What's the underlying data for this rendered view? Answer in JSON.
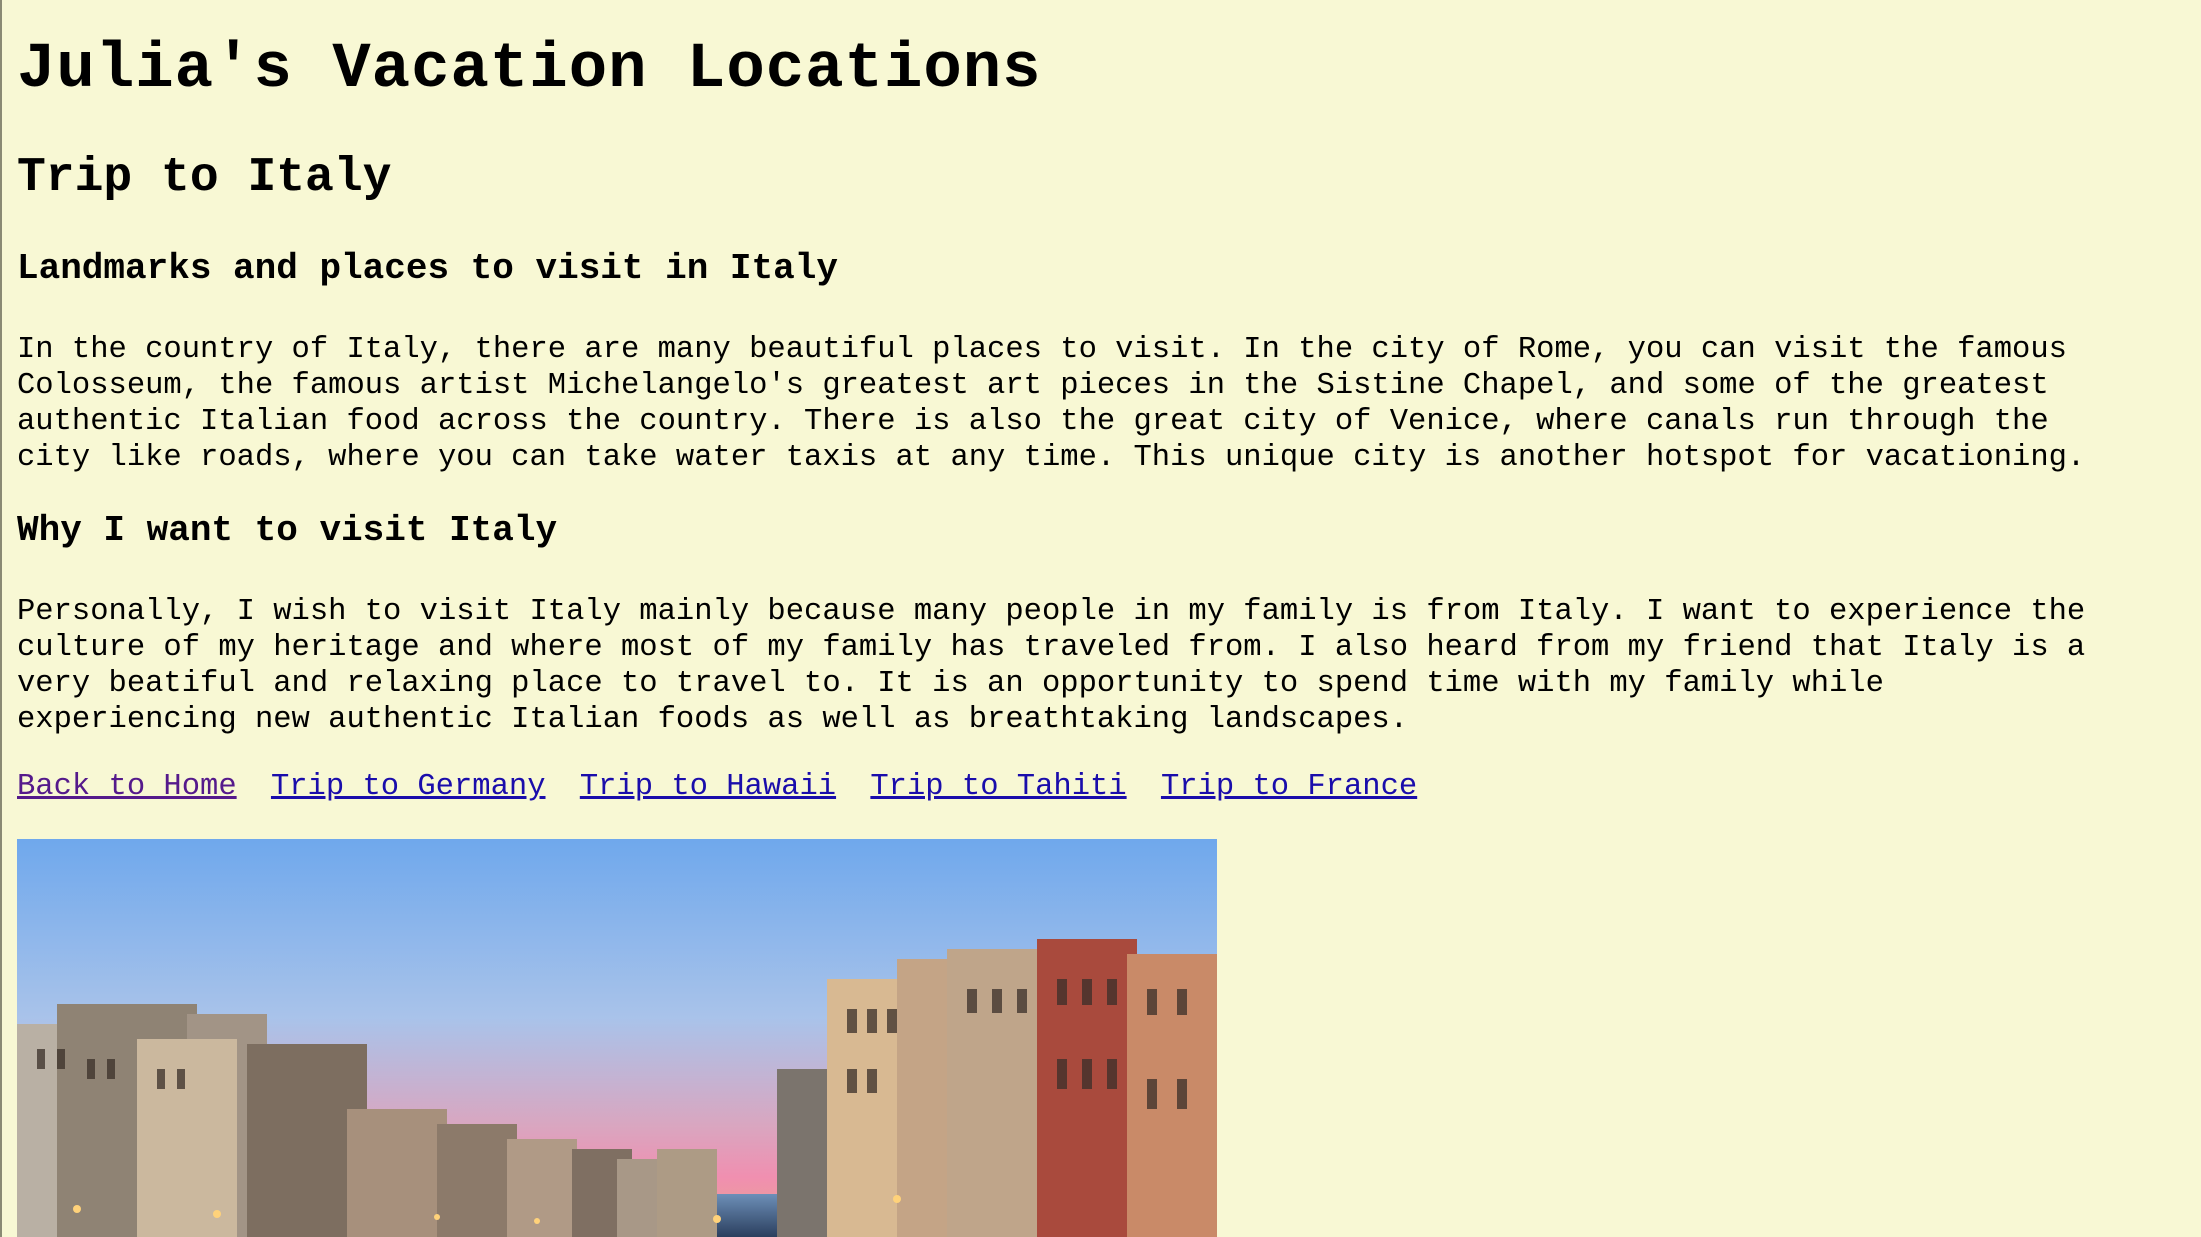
{
  "page": {
    "title": "Julia's Vacation Locations",
    "subtitle": "Trip to Italy"
  },
  "sections": [
    {
      "heading": "Landmarks and places to visit in Italy",
      "body": "In the country of Italy, there are many beautiful places to visit. In the city of Rome, you can visit the famous\nColosseum, the famous artist Michelangelo's greatest art pieces in the Sistine Chapel, and some of the greatest\nauthentic Italian food across the country. There is also the great city of Venice, where canals run through the\ncity like roads, where you can take water taxis at any time. This unique city is another hotspot for vacationing."
    },
    {
      "heading": "Why I want to visit Italy",
      "body": "Personally, I wish to visit Italy mainly because many people in my family is from Italy. I want to experience the\nculture of my heritage and where most of my family has traveled from. I also heard from my friend that Italy is a\nvery beatiful and relaxing place to travel to. It is an opportunity to spend time with my family while\nexperiencing new authentic Italian foods as well as breathtaking landscapes."
    }
  ],
  "nav_links": [
    {
      "label": "Back to Home",
      "visited": true
    },
    {
      "label": "Trip to Germany",
      "visited": false
    },
    {
      "label": "Trip to Hawaii",
      "visited": false
    },
    {
      "label": "Trip to Tahiti",
      "visited": false
    },
    {
      "label": "Trip to France",
      "visited": false
    }
  ],
  "colors": {
    "background": "#f8f8d4",
    "link": "#1a0dab",
    "visited_link": "#551a8b"
  }
}
